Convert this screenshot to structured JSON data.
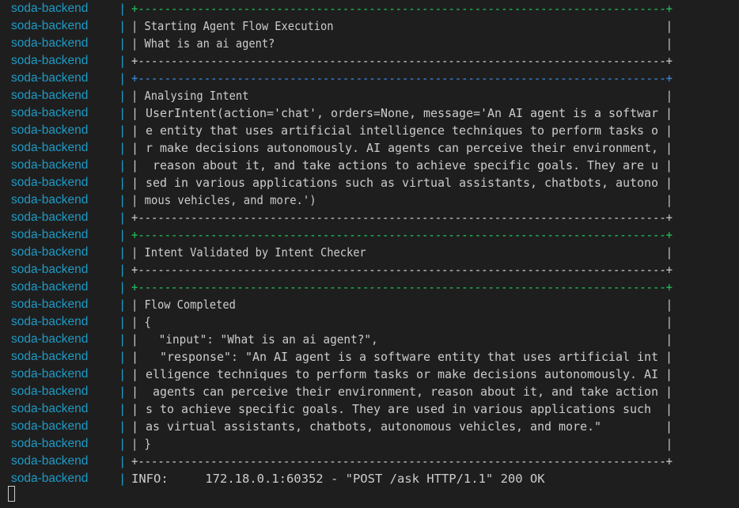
{
  "service_name": "soda-backend",
  "separator": "|",
  "colors": {
    "background": "#1e1e1e",
    "service": "#1e9ac4",
    "text": "#cccccc",
    "border_green": "#23c55e",
    "border_blue": "#3b8eea"
  },
  "lines": [
    {
      "text": "+--------------------------------------------------------------------------------+",
      "style": "border-green"
    },
    {
      "text": "| Starting Agent Flow Execution                                                   |",
      "style": "plain"
    },
    {
      "text": "| What is an ai agent?                                                            |",
      "style": "plain"
    },
    {
      "text": "+--------------------------------------------------------------------------------+",
      "style": "border-plain"
    },
    {
      "text": "+--------------------------------------------------------------------------------+",
      "style": "border-blue"
    },
    {
      "text": "| Analysing Intent                                                                |",
      "style": "plain"
    },
    {
      "text": "| UserIntent(action='chat', orders=None, message='An AI agent is a softwar |",
      "style": "plain"
    },
    {
      "text": "| e entity that uses artificial intelligence techniques to perform tasks o |",
      "style": "plain"
    },
    {
      "text": "| r make decisions autonomously. AI agents can perceive their environment, |",
      "style": "plain"
    },
    {
      "text": "|  reason about it, and take actions to achieve specific goals. They are u |",
      "style": "plain"
    },
    {
      "text": "| sed in various applications such as virtual assistants, chatbots, autono |",
      "style": "plain"
    },
    {
      "text": "| mous vehicles, and more.')                                                     |",
      "style": "plain"
    },
    {
      "text": "+--------------------------------------------------------------------------------+",
      "style": "border-plain"
    },
    {
      "text": "+--------------------------------------------------------------------------------+",
      "style": "border-green"
    },
    {
      "text": "| Intent Validated by Intent Checker                                              |",
      "style": "plain"
    },
    {
      "text": "+--------------------------------------------------------------------------------+",
      "style": "border-plain"
    },
    {
      "text": "+--------------------------------------------------------------------------------+",
      "style": "border-green"
    },
    {
      "text": "| Flow Completed                                                                  |",
      "style": "plain"
    },
    {
      "text": "| {                                                                               |",
      "style": "plain"
    },
    {
      "text": "|   \"input\": \"What is an ai agent?\",                                          |",
      "style": "plain"
    },
    {
      "text": "|   \"response\": \"An AI agent is a software entity that uses artificial int |",
      "style": "plain"
    },
    {
      "text": "| elligence techniques to perform tasks or make decisions autonomously. AI |",
      "style": "plain"
    },
    {
      "text": "|  agents can perceive their environment, reason about it, and take action |",
      "style": "plain"
    },
    {
      "text": "| s to achieve specific goals. They are used in various applications such  |",
      "style": "plain"
    },
    {
      "text": "| as virtual assistants, chatbots, autonomous vehicles, and more.\"         |",
      "style": "plain"
    },
    {
      "text": "| }                                                                               |",
      "style": "plain"
    },
    {
      "text": "+--------------------------------------------------------------------------------+",
      "style": "border-plain"
    },
    {
      "text": "INFO:     172.18.0.1:60352 - \"POST /ask HTTP/1.1\" 200 OK",
      "style": "plain"
    }
  ]
}
